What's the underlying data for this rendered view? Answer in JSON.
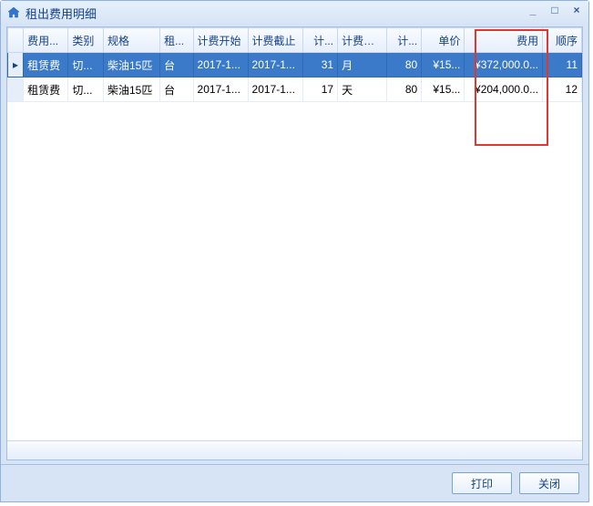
{
  "window": {
    "title": "租出费用明细"
  },
  "columns": {
    "fee_name": "费用...",
    "category": "类别",
    "spec": "规格",
    "rent": "租...",
    "start": "计费开始",
    "end": "计费截止",
    "count1": "计...",
    "days": "计费天...",
    "count2": "计...",
    "unit_price": "单价",
    "fee": "费用",
    "order": "顺序"
  },
  "rows": [
    {
      "fee_name": "租赁费",
      "category": "切...",
      "spec": "柴油15匹",
      "rent": "台",
      "start": "2017-1...",
      "end": "2017-1...",
      "count1": "31",
      "days": "月",
      "count2": "80",
      "unit_price": "¥15...",
      "fee": "¥372,000.0...",
      "order": "11"
    },
    {
      "fee_name": "租赁费",
      "category": "切...",
      "spec": "柴油15匹",
      "rent": "台",
      "start": "2017-1...",
      "end": "2017-1...",
      "count1": "17",
      "days": "天",
      "count2": "80",
      "unit_price": "¥15...",
      "fee": "¥204,000.0...",
      "order": "12"
    }
  ],
  "footer": {
    "print": "打印",
    "close": "关闭"
  }
}
